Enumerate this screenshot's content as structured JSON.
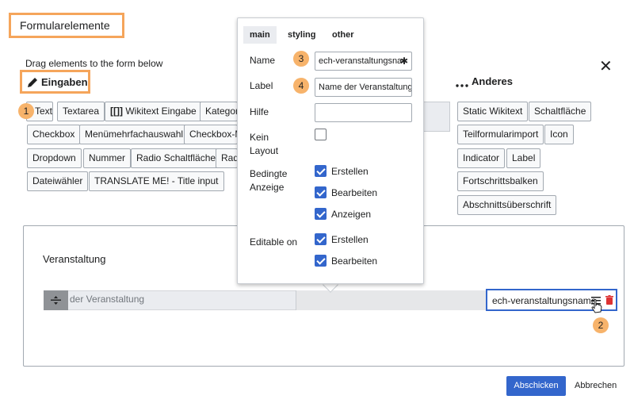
{
  "header": {
    "title": "Formularelemente",
    "hint": "Drag elements to the form below",
    "close_glyph": "✕"
  },
  "groups": {
    "inputs": {
      "label": "Eingaben",
      "icon": "pencil-icon"
    },
    "other": {
      "label": "Anderes",
      "icon": "ellipsis-icon"
    }
  },
  "input_chips": [
    "Text",
    "Textarea",
    "Wikitext Eingabe",
    "Kategor",
    "Checkbox",
    "Menümehrfachauswahl",
    "Checkbox-M",
    "Dropdown",
    "Nummer",
    "Radio Schaltfläche",
    "Rad",
    "Dateiwähler",
    "TRANSLATE ME! - Title input"
  ],
  "other_chips": [
    "Static Wikitext",
    "Schaltfläche",
    "Teilformularimport",
    "Icon",
    "Indicator",
    "Label",
    "Fortschrittsbalken",
    "Abschnittsüberschrift"
  ],
  "wikitext_icon_glyph": "[[]]",
  "popup": {
    "tabs": [
      "main",
      "styling",
      "other"
    ],
    "active_tab": "main",
    "fields": {
      "name_label": "Name",
      "name_value": "ech-veranstaltungsna",
      "name_required": "✱",
      "label_label": "Label",
      "label_value": "Name der Veranstaltung",
      "help_label": "Hilfe",
      "help_value": "",
      "no_layout_label": "Kein Layout",
      "no_layout_checked": false,
      "conditional_label": "Bedingte Anzeige",
      "conditional_options": [
        {
          "label": "Erstellen",
          "checked": true
        },
        {
          "label": "Bearbeiten",
          "checked": true
        },
        {
          "label": "Anzeigen",
          "checked": true
        }
      ],
      "editable_label": "Editable on",
      "editable_options": [
        {
          "label": "Erstellen",
          "checked": true
        },
        {
          "label": "Bearbeiten",
          "checked": true
        }
      ]
    }
  },
  "form": {
    "section_title": "Veranstaltung",
    "row_label_fragment": "der Veranstaltung",
    "selected_field_name": "ech-veranstaltungsname"
  },
  "badges": [
    "1",
    "2",
    "3",
    "4"
  ],
  "footer": {
    "submit_label": "Abschicken",
    "cancel_label": "Abbrechen"
  },
  "colors": {
    "highlight": "#f5a55b",
    "badge": "#f7b36b",
    "primary": "#3366cc",
    "delete": "#d33"
  }
}
